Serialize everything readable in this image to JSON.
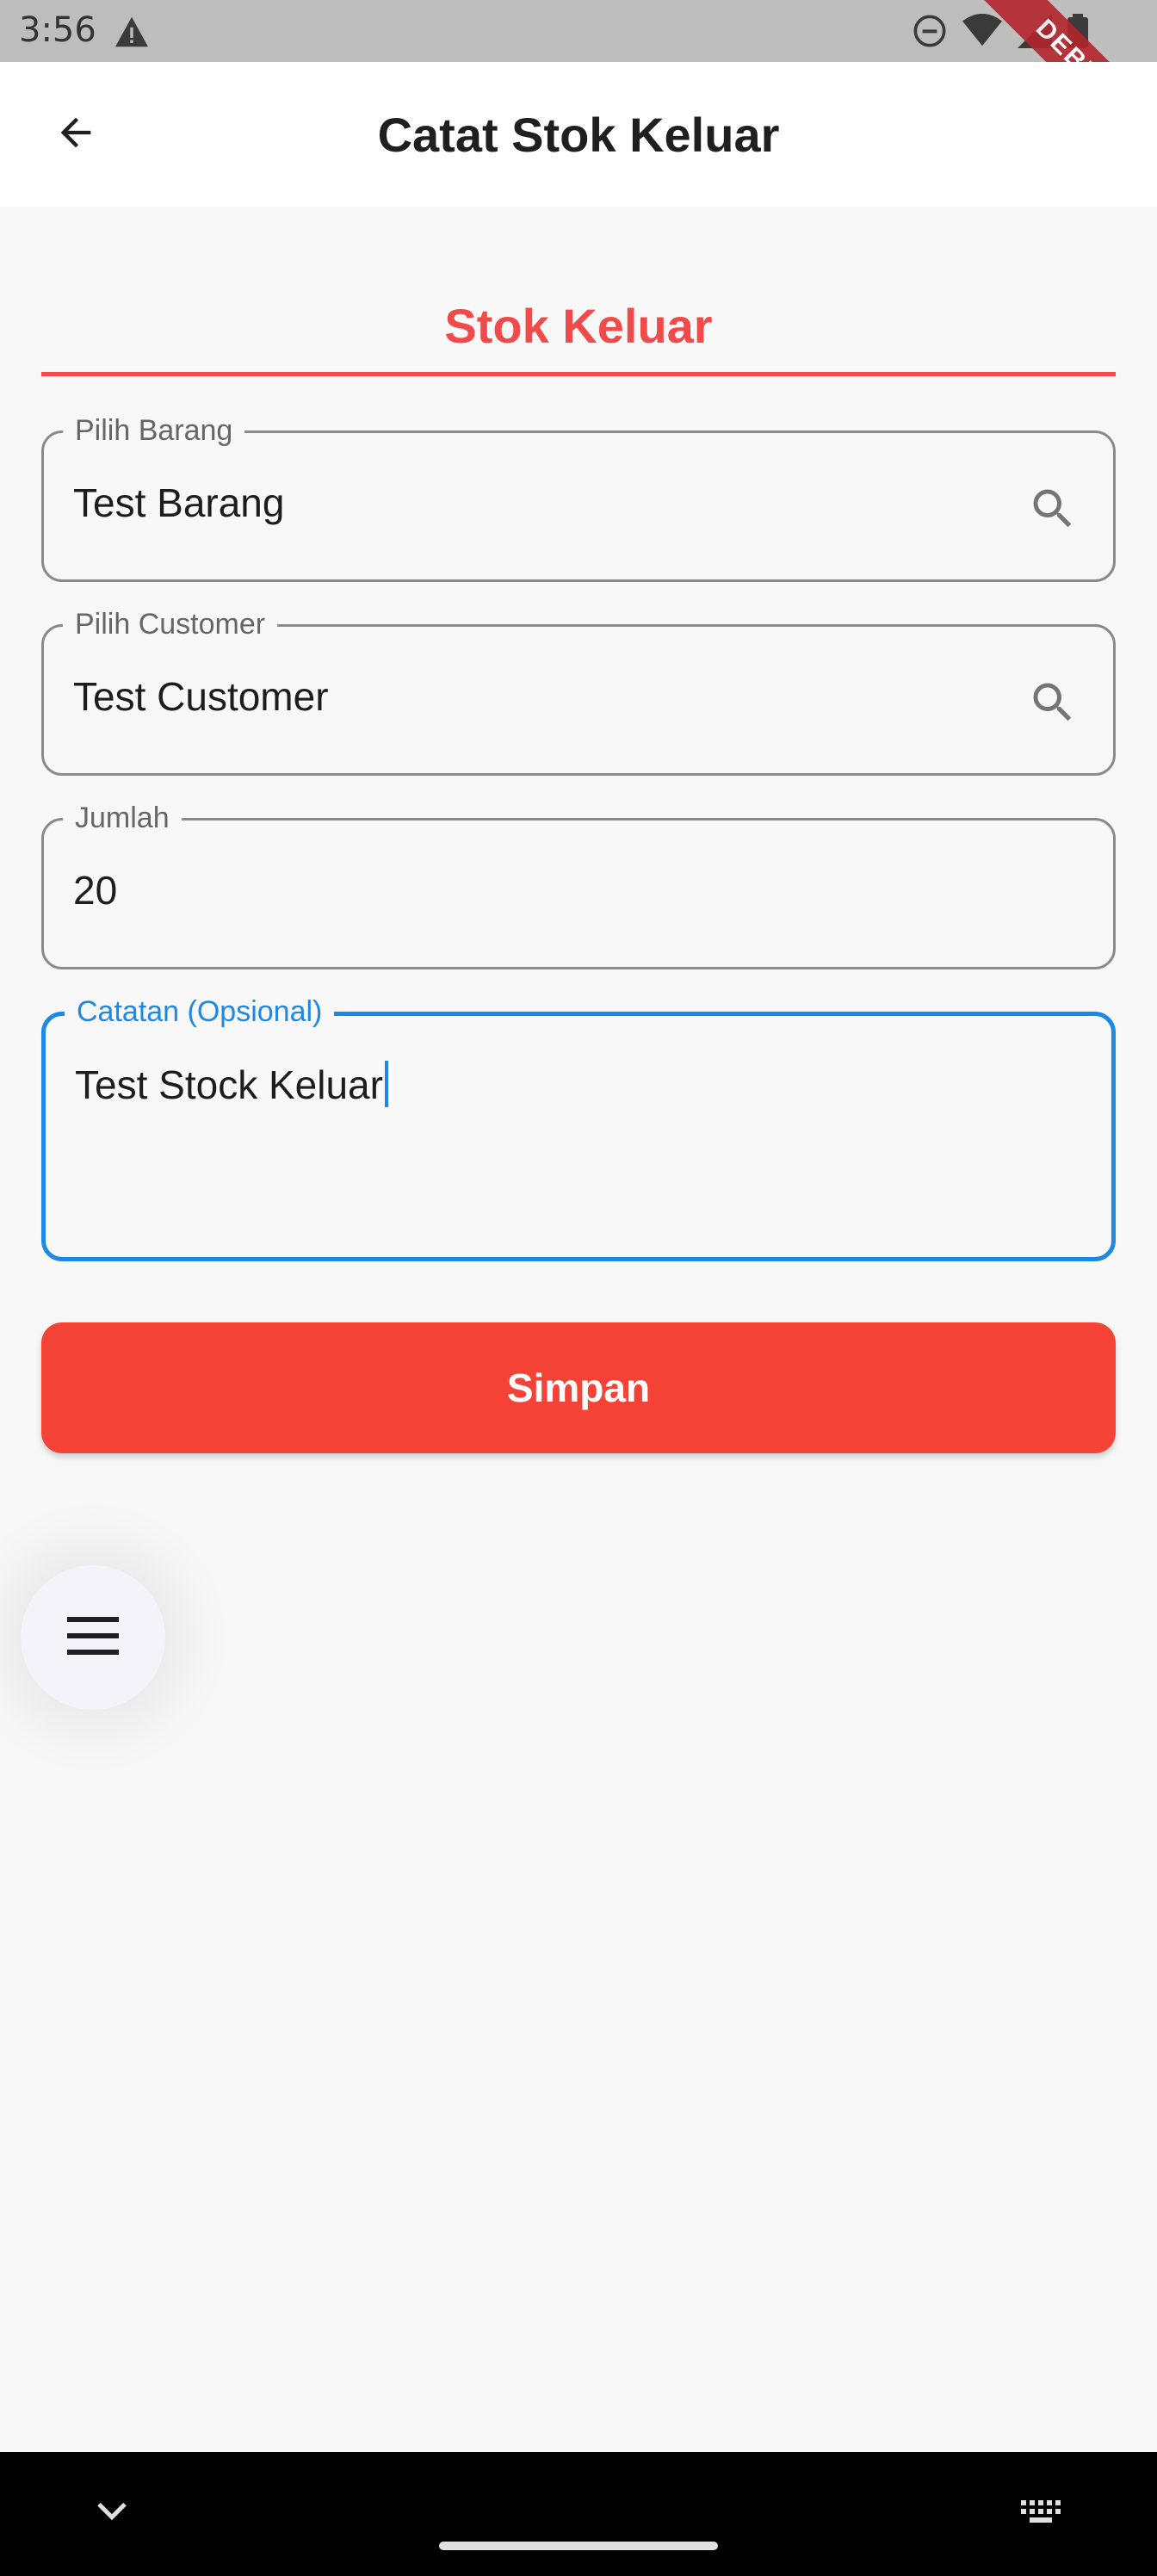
{
  "status_bar": {
    "time": "3:56",
    "icons": [
      "warning-icon",
      "do-not-disturb-icon",
      "wifi-icon",
      "signal-icon",
      "battery-icon"
    ],
    "debug_banner": "DEBUG"
  },
  "app_bar": {
    "back_icon": "arrow-back-icon",
    "title": "Catat Stok Keluar"
  },
  "form": {
    "section_title": "Stok Keluar",
    "fields": [
      {
        "label": "Pilih Barang",
        "value": "Test Barang",
        "icon": "search-icon"
      },
      {
        "label": "Pilih Customer",
        "value": "Test Customer",
        "icon": "search-icon"
      },
      {
        "label": "Jumlah",
        "value": "20"
      },
      {
        "label": "Catatan (Opsional)",
        "value": "Test Stock Keluar",
        "focused": true
      }
    ],
    "submit_label": "Simpan"
  },
  "fab": {
    "icon": "menu-icon"
  },
  "nav_bar": {
    "icons": [
      "chevron-down-icon",
      "home-handle",
      "keyboard-icon"
    ]
  },
  "colors": {
    "accent_red": "#f04a4a",
    "button_red": "#f44336",
    "focus_blue": "#1e88e5"
  }
}
